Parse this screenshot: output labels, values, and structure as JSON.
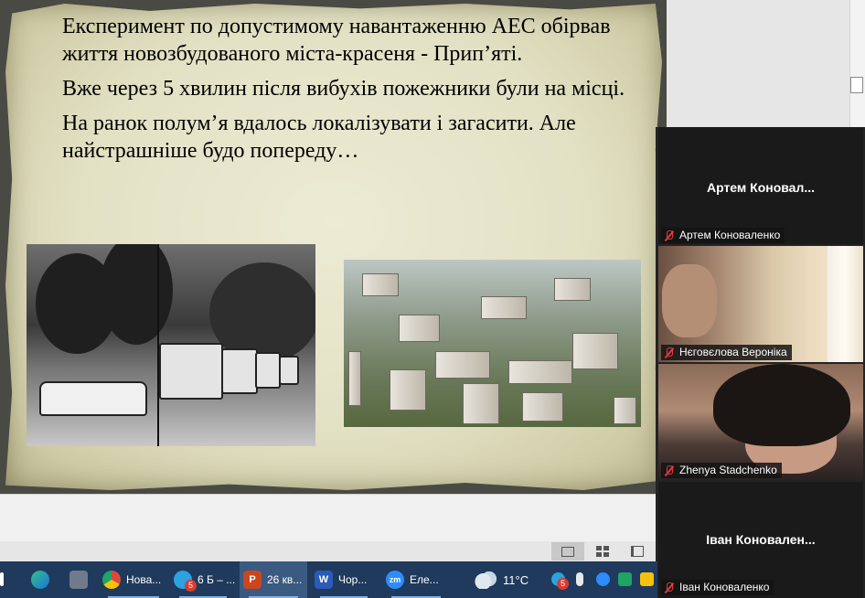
{
  "slide": {
    "paragraphs": [
      " Експеримент по допустимому навантаженню АЕС обірвав життя новозбудованого міста-красеня - Прип’яті.",
      " Вже через 5 хвилин після вибухів пожежники були на місці.",
      " На ранок полум’я вдалось локалізувати і загасити. Але найстрашніше будо попереду…"
    ]
  },
  "zoom": {
    "participants": [
      {
        "display": "Артем  Коновал...",
        "tag": "Артем Коноваленко",
        "muted": true,
        "video": false
      },
      {
        "display": "",
        "tag": "Нєговєлова Вероніка",
        "muted": true,
        "video": true
      },
      {
        "display": "",
        "tag": "Zhenya Stadchenko",
        "muted": true,
        "video": true
      },
      {
        "display": "Іван  Коновален...",
        "tag": "Іван Коноваленко",
        "muted": true,
        "video": false
      }
    ]
  },
  "taskbar": {
    "items": [
      {
        "id": "chrome",
        "label": "Нова...",
        "color": "#e0483e"
      },
      {
        "id": "telegram",
        "label": "6 Б – ...",
        "color": "#2aa3e0",
        "badge": "5"
      },
      {
        "id": "powerpoint",
        "label": "26 кв...",
        "color": "#c9461f"
      },
      {
        "id": "word",
        "label": "Чор...",
        "color": "#2b5bb8"
      },
      {
        "id": "zoom",
        "label": "Еле...",
        "color": "#2d8cff"
      }
    ],
    "weather": "11°C",
    "tray_badge": "5"
  },
  "colors": {
    "taskbar": "#1f3a5c",
    "zoom_panel": "#232323",
    "muted_red": "#e23b3b"
  }
}
